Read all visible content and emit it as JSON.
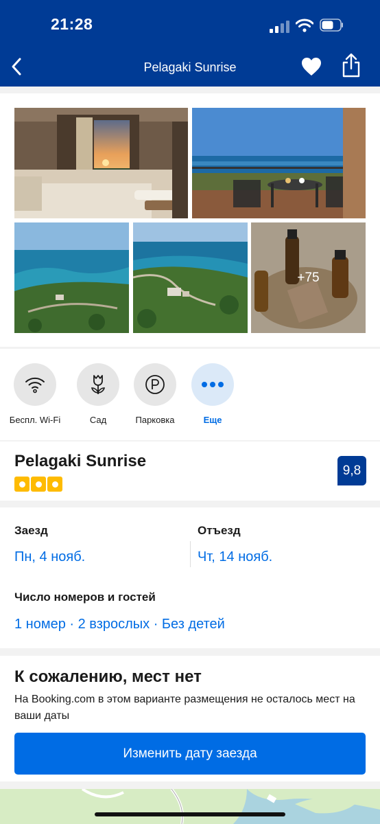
{
  "status_bar": {
    "time": "21:28"
  },
  "nav": {
    "title": "Pelagaki Sunrise"
  },
  "gallery": {
    "more_count": "+75"
  },
  "facilities": [
    {
      "label": "Беспл. Wi-Fi",
      "icon": "wifi-icon"
    },
    {
      "label": "Сад",
      "icon": "tulip-icon"
    },
    {
      "label": "Парковка",
      "icon": "parking-icon"
    },
    {
      "label": "Еще",
      "icon": "more-dots-icon"
    }
  ],
  "hotel": {
    "name": "Pelagaki Sunrise",
    "stars": 3,
    "score": "9,8"
  },
  "booking": {
    "checkin_label": "Заезд",
    "checkin_value": "Пн, 4 нояб.",
    "checkout_label": "Отъезд",
    "checkout_value": "Чт, 14 нояб.",
    "guests_label": "Число номеров и гостей",
    "guests_value": "1 номер · 2 взрослых · Без детей"
  },
  "availability": {
    "title": "К сожалению, мест нет",
    "message": "На Booking.com в этом варианте размещения не осталось мест на ваши даты",
    "button_label": "Изменить дату заезда"
  },
  "colors": {
    "brand_blue": "#003b95",
    "link_blue": "#006ce4",
    "star_yellow": "#febb02"
  }
}
